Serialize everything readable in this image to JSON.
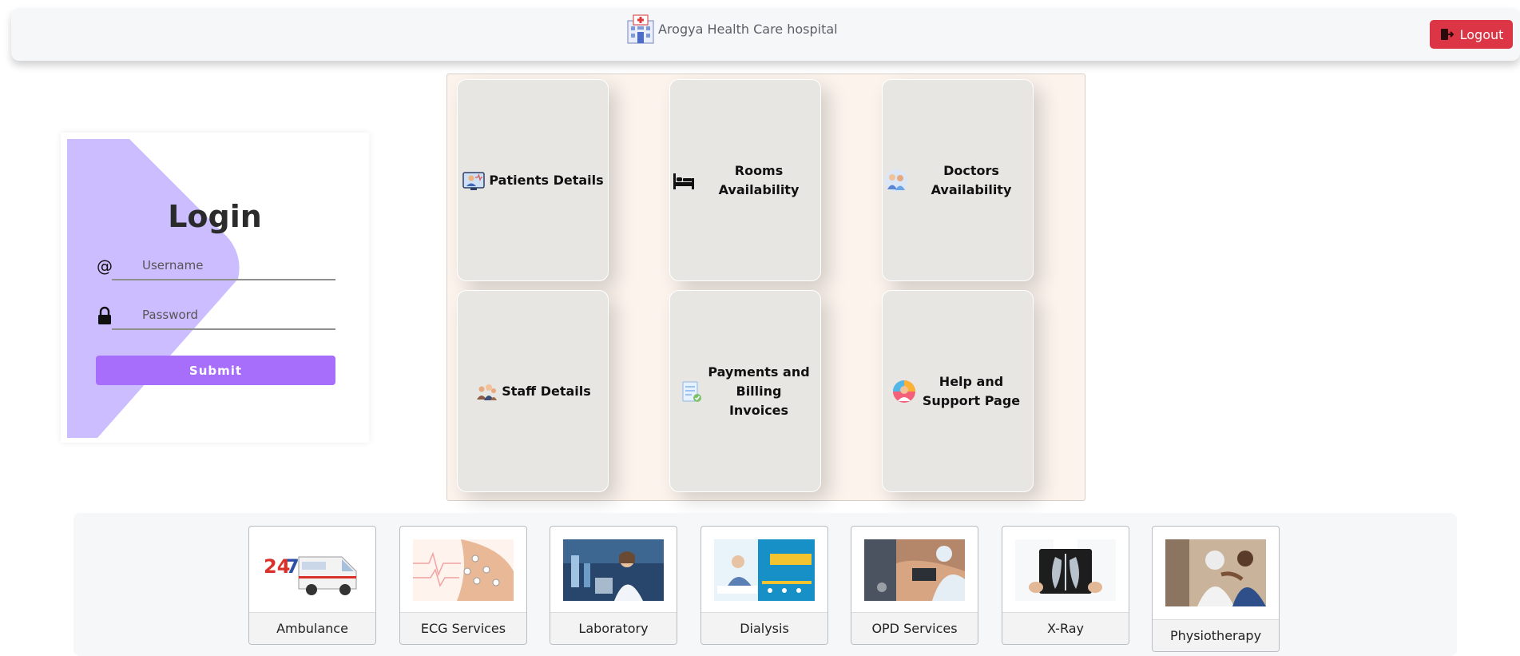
{
  "navbar": {
    "brand_text": "Arogya Health Care hospital",
    "brand_icon": "hospital-building-icon",
    "logout_label": "Logout",
    "logout_icon": "logout-door-icon",
    "logout_color": "#dc3545"
  },
  "login": {
    "title": "Login",
    "username": {
      "icon": "at-sign-icon",
      "placeholder": "Username",
      "value": ""
    },
    "password": {
      "icon": "lock-icon",
      "placeholder": "Password",
      "value": ""
    },
    "submit_label": "Submit",
    "accent_color": "#a66efa",
    "deco_color": "#cbbdff"
  },
  "dashboard": {
    "tiles": [
      {
        "label": "Patients Details",
        "icon": "patient-monitor-icon"
      },
      {
        "label": "Rooms Availability",
        "icon": "bed-icon"
      },
      {
        "label": "Doctors Availability",
        "icon": "doctors-icon"
      },
      {
        "label": "Staff Details",
        "icon": "staff-icon"
      },
      {
        "label": "Payments and Billing Invoices",
        "icon": "invoice-icon"
      },
      {
        "label": "Help and Support Page",
        "icon": "support-agent-icon"
      }
    ]
  },
  "services": [
    {
      "label": "Ambulance",
      "image": "ambulance-image"
    },
    {
      "label": "ECG Services",
      "image": "ecg-image"
    },
    {
      "label": "Laboratory",
      "image": "laboratory-image"
    },
    {
      "label": "Dialysis",
      "image": "dialysis-image"
    },
    {
      "label": "OPD Services",
      "image": "opd-image"
    },
    {
      "label": "X-Ray",
      "image": "xray-image"
    },
    {
      "label": "Physiotherapy",
      "image": "physiotherapy-image"
    }
  ]
}
